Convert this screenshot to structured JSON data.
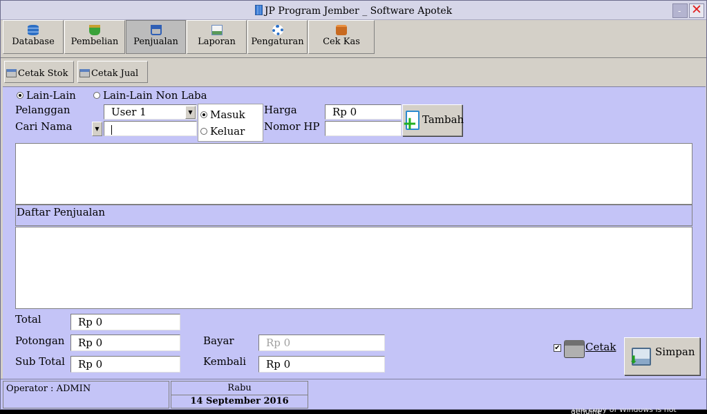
{
  "window": {
    "title": "JP Program Jember _ Software Apotek",
    "min_label": "-",
    "close_label": "✕"
  },
  "toolbar": [
    {
      "label": "Database",
      "icon": "database-icon"
    },
    {
      "label": "Pembelian",
      "icon": "basket-icon"
    },
    {
      "label": "Penjualan",
      "icon": "cart-icon",
      "active": true
    },
    {
      "label": "Laporan",
      "icon": "report-icon"
    },
    {
      "label": "Pengaturan",
      "icon": "gear-icon"
    },
    {
      "label": "Cek Kas",
      "icon": "wallet-icon"
    }
  ],
  "subtoolbar": {
    "cetak_stok": "Cetak Stok",
    "cetak_jual": "Cetak Jual"
  },
  "form": {
    "radio_lain": "Lain-Lain",
    "radio_lain_non_laba": "Lain-Lain Non Laba",
    "pelanggan_label": "Pelanggan",
    "pelanggan_value": "User 1",
    "cari_nama_label": "Cari Nama",
    "cari_nama_value": "",
    "masuk": "Masuk",
    "keluar": "Keluar",
    "harga_label": "Harga",
    "harga_value": "Rp 0",
    "nomor_hp_label": "Nomor HP",
    "nomor_hp_value": "",
    "tambah_label": "Tambah"
  },
  "list": {
    "daftar_label": "Daftar Penjualan"
  },
  "totals": {
    "total_label": "Total",
    "total_value": "Rp 0",
    "potongan_label": "Potongan",
    "potongan_value": "Rp 0",
    "subtotal_label": "Sub Total",
    "subtotal_value": "Rp 0",
    "bayar_label": "Bayar",
    "bayar_value": "Rp 0",
    "kembali_label": "Kembali",
    "kembali_value": "Rp 0"
  },
  "actions": {
    "cetak_label": "Cetak",
    "cetak_checked": true,
    "simpan_label": "Simpan"
  },
  "status": {
    "operator_label": "Operator  :  ",
    "operator_value": "ADMIN",
    "day": "Rabu",
    "date": "14 September 2016"
  },
  "watermark": "This copy of Windows is not genuine"
}
